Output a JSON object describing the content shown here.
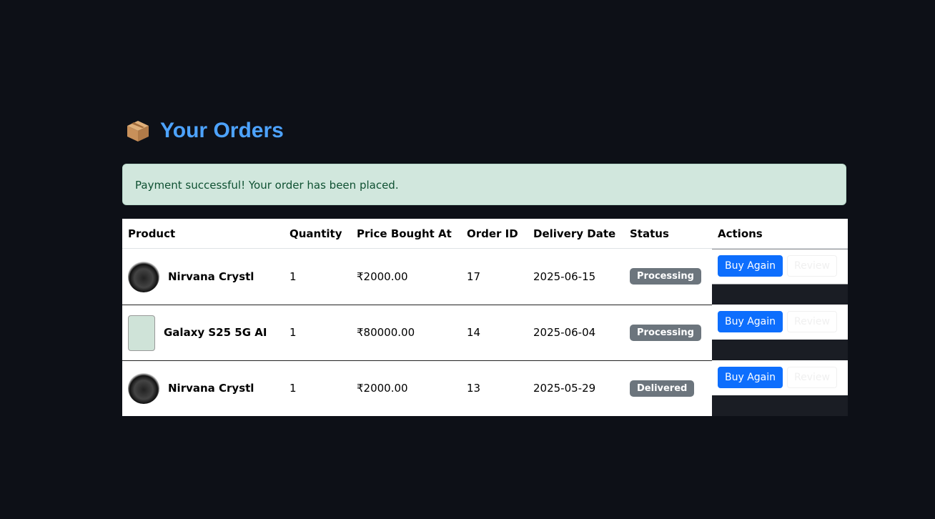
{
  "page": {
    "title": "Your Orders",
    "title_icon": "package-icon"
  },
  "alert": {
    "message": "Payment successful! Your order has been placed."
  },
  "table": {
    "headers": [
      "Product",
      "Quantity",
      "Price Bought At",
      "Order ID",
      "Delivery Date",
      "Status",
      "Actions"
    ],
    "rows": [
      {
        "product": "Nirvana Crystl",
        "quantity": "1",
        "price": "₹2000.00",
        "order_id": "17",
        "delivery_date": "2025-06-15",
        "status": "Processing",
        "buy_again": "Buy Again",
        "review": "Review"
      },
      {
        "product": "Galaxy S25 5G AI",
        "quantity": "1",
        "price": "₹80000.00",
        "order_id": "14",
        "delivery_date": "2025-06-04",
        "status": "Processing",
        "buy_again": "Buy Again",
        "review": "Review"
      },
      {
        "product": "Nirvana Crystl",
        "quantity": "1",
        "price": "₹2000.00",
        "order_id": "13",
        "delivery_date": "2025-05-29",
        "status": "Delivered",
        "buy_again": "Buy Again",
        "review": "Review"
      }
    ]
  },
  "colors": {
    "accent": "#4da3ff",
    "primary": "#0d6efd",
    "badge": "#6c757d",
    "alert_bg": "#d1e7dd"
  }
}
